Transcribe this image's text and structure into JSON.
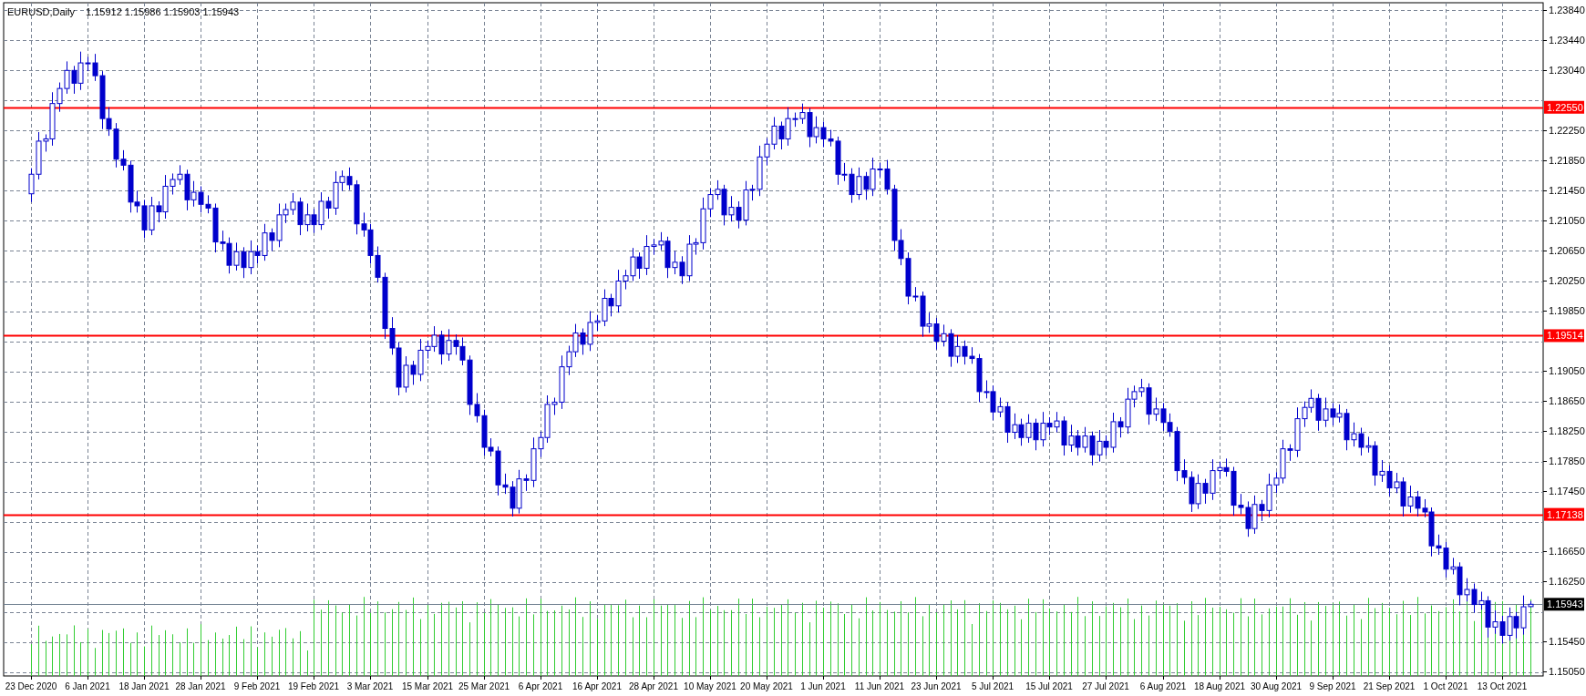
{
  "header": {
    "ohlc": "1.15912 1.15986 1.15903 1.15943"
  },
  "chart": {
    "chart_data": {
      "type": "candlestick",
      "title": "EURUSD,Daily",
      "grid": true,
      "categories": [
        "23 Dec 2020",
        null,
        null,
        null,
        null,
        null,
        null,
        null,
        "6 Jan 2021",
        null,
        null,
        null,
        null,
        null,
        null,
        null,
        "18 Jan 2021",
        null,
        null,
        null,
        null,
        null,
        null,
        null,
        "28 Jan 2021",
        null,
        null,
        null,
        null,
        null,
        null,
        null,
        "9 Feb 2021",
        null,
        null,
        null,
        null,
        null,
        null,
        null,
        "19 Feb 2021",
        null,
        null,
        null,
        null,
        null,
        null,
        null,
        "3 Mar 2021",
        null,
        null,
        null,
        null,
        null,
        null,
        null,
        "15 Mar 2021",
        null,
        null,
        null,
        null,
        null,
        null,
        null,
        "25 Mar 2021",
        null,
        null,
        null,
        null,
        null,
        null,
        null,
        "6 Apr 2021",
        null,
        null,
        null,
        null,
        null,
        null,
        null,
        "16 Apr 2021",
        null,
        null,
        null,
        null,
        null,
        null,
        null,
        "28 Apr 2021",
        null,
        null,
        null,
        null,
        null,
        null,
        null,
        "10 May 2021",
        null,
        null,
        null,
        null,
        null,
        null,
        null,
        "20 May 2021",
        null,
        null,
        null,
        null,
        null,
        null,
        null,
        "1 Jun 2021",
        null,
        null,
        null,
        null,
        null,
        null,
        null,
        "11 Jun 2021",
        null,
        null,
        null,
        null,
        null,
        null,
        null,
        "23 Jun 2021",
        null,
        null,
        null,
        null,
        null,
        null,
        null,
        "5 Jul 2021",
        null,
        null,
        null,
        null,
        null,
        null,
        null,
        "15 Jul 2021",
        null,
        null,
        null,
        null,
        null,
        null,
        null,
        "27 Jul 2021",
        null,
        null,
        null,
        null,
        null,
        null,
        null,
        "6 Aug 2021",
        null,
        null,
        null,
        null,
        null,
        null,
        null,
        "18 Aug 2021",
        null,
        null,
        null,
        null,
        null,
        null,
        null,
        "30 Aug 2021",
        null,
        null,
        null,
        null,
        null,
        null,
        null,
        "9 Sep 2021",
        null,
        null,
        null,
        null,
        null,
        null,
        null,
        "21 Sep 2021",
        null,
        null,
        null,
        null,
        null,
        null,
        null,
        "1 Oct 2021",
        null,
        null,
        null,
        null,
        null,
        null,
        null,
        "13 Oct 2021",
        null,
        null,
        null,
        null
      ],
      "ohlc": [
        [
          1.214,
          1.2174,
          1.2129,
          1.2166
        ],
        [
          1.2166,
          1.2222,
          1.2159,
          1.221
        ],
        [
          1.221,
          1.2219,
          1.2196,
          1.2213
        ],
        [
          1.2213,
          1.2275,
          1.2204,
          1.226
        ],
        [
          1.226,
          1.2288,
          1.2249,
          1.228
        ],
        [
          1.228,
          1.2316,
          1.2273,
          1.2304
        ],
        [
          1.2304,
          1.231,
          1.2273,
          1.2287
        ],
        [
          1.2287,
          1.2329,
          1.2278,
          1.2314
        ],
        [
          1.2314,
          1.2322,
          1.2303,
          1.2314
        ],
        [
          1.2314,
          1.2326,
          1.229,
          1.2297
        ],
        [
          1.2297,
          1.2303,
          1.2226,
          1.224
        ],
        [
          1.224,
          1.2255,
          1.2217,
          1.2226
        ],
        [
          1.2226,
          1.2234,
          1.2175,
          1.2186
        ],
        [
          1.2186,
          1.2198,
          1.2171,
          1.2178
        ],
        [
          1.2178,
          1.2184,
          1.2115,
          1.2129
        ],
        [
          1.2129,
          1.2144,
          1.2115,
          1.2124
        ],
        [
          1.2124,
          1.2132,
          1.2081,
          1.2092
        ],
        [
          1.2092,
          1.2136,
          1.2085,
          1.2124
        ],
        [
          1.2124,
          1.213,
          1.2102,
          1.2116
        ],
        [
          1.2116,
          1.2165,
          1.2107,
          1.215
        ],
        [
          1.215,
          1.2167,
          1.2139,
          1.2159
        ],
        [
          1.2159,
          1.2178,
          1.2152,
          1.2166
        ],
        [
          1.2166,
          1.2172,
          1.2118,
          1.2132
        ],
        [
          1.2132,
          1.2157,
          1.2123,
          1.2142
        ],
        [
          1.2142,
          1.215,
          1.2115,
          1.2126
        ],
        [
          1.2126,
          1.2138,
          1.2114,
          1.2121
        ],
        [
          1.2121,
          1.2127,
          1.2062,
          1.2076
        ],
        [
          1.2076,
          1.2091,
          1.2065,
          1.2074
        ],
        [
          1.2074,
          1.2082,
          1.2034,
          1.2045
        ],
        [
          1.2045,
          1.2075,
          1.2038,
          1.2063
        ],
        [
          1.2063,
          1.2069,
          1.2028,
          1.2042
        ],
        [
          1.2042,
          1.2078,
          1.2033,
          1.2063
        ],
        [
          1.2063,
          1.2071,
          1.2047,
          1.2058
        ],
        [
          1.2058,
          1.21,
          1.2051,
          1.2088
        ],
        [
          1.2088,
          1.2094,
          1.2064,
          1.2078
        ],
        [
          1.2078,
          1.2127,
          1.2069,
          1.2112
        ],
        [
          1.2112,
          1.2127,
          1.2101,
          1.2119
        ],
        [
          1.2119,
          1.2141,
          1.2112,
          1.2129
        ],
        [
          1.2129,
          1.2135,
          1.2085,
          1.2099
        ],
        [
          1.2099,
          1.2127,
          1.209,
          1.2112
        ],
        [
          1.2112,
          1.212,
          1.2088,
          1.2099
        ],
        [
          1.2099,
          1.2142,
          1.2092,
          1.213
        ],
        [
          1.213,
          1.2136,
          1.2107,
          1.2121
        ],
        [
          1.2121,
          1.217,
          1.2112,
          1.2155
        ],
        [
          1.2155,
          1.2171,
          1.2144,
          1.2163
        ],
        [
          1.2163,
          1.2175,
          1.2145,
          1.2152
        ],
        [
          1.2152,
          1.2158,
          1.2086,
          1.21
        ],
        [
          1.21,
          1.2115,
          1.2083,
          1.2092
        ],
        [
          1.2092,
          1.21,
          1.2047,
          1.2058
        ],
        [
          1.2058,
          1.207,
          1.2022,
          1.2029
        ],
        [
          1.2029,
          1.2035,
          1.1947,
          1.1961
        ],
        [
          1.1961,
          1.1976,
          1.1926,
          1.1935
        ],
        [
          1.1935,
          1.1943,
          1.1872,
          1.1883
        ],
        [
          1.1883,
          1.1924,
          1.1876,
          1.1912
        ],
        [
          1.1912,
          1.1918,
          1.1886,
          1.19
        ],
        [
          1.19,
          1.1947,
          1.1891,
          1.1932
        ],
        [
          1.1932,
          1.1945,
          1.1921,
          1.1937
        ],
        [
          1.1937,
          1.1964,
          1.193,
          1.1952
        ],
        [
          1.1952,
          1.1958,
          1.1913,
          1.1927
        ],
        [
          1.1927,
          1.196,
          1.1918,
          1.1945
        ],
        [
          1.1945,
          1.1953,
          1.1926,
          1.1937
        ],
        [
          1.1937,
          1.1949,
          1.1912,
          1.1919
        ],
        [
          1.1919,
          1.1925,
          1.1846,
          1.186
        ],
        [
          1.186,
          1.1875,
          1.1836,
          1.1845
        ],
        [
          1.1845,
          1.1853,
          1.1792,
          1.1803
        ],
        [
          1.1803,
          1.1815,
          1.1791,
          1.1798
        ],
        [
          1.1798,
          1.1804,
          1.1739,
          1.1753
        ],
        [
          1.1753,
          1.1768,
          1.1741,
          1.175
        ],
        [
          1.175,
          1.1758,
          1.1711,
          1.1722
        ],
        [
          1.1722,
          1.1773,
          1.1715,
          1.1761
        ],
        [
          1.1761,
          1.1767,
          1.1745,
          1.1759
        ],
        [
          1.1759,
          1.1816,
          1.175,
          1.1801
        ],
        [
          1.1801,
          1.1824,
          1.179,
          1.1816
        ],
        [
          1.1816,
          1.1872,
          1.1809,
          1.186
        ],
        [
          1.186,
          1.1869,
          1.1846,
          1.1863
        ],
        [
          1.1863,
          1.1925,
          1.1854,
          1.191
        ],
        [
          1.191,
          1.1938,
          1.1899,
          1.193
        ],
        [
          1.193,
          1.1967,
          1.1923,
          1.1955
        ],
        [
          1.1955,
          1.1961,
          1.1926,
          1.194
        ],
        [
          1.194,
          1.1984,
          1.1931,
          1.1969
        ],
        [
          1.1969,
          1.1979,
          1.1958,
          1.1971
        ],
        [
          1.1971,
          1.2013,
          1.1964,
          1.2001
        ],
        [
          1.2001,
          1.2007,
          1.1977,
          1.1991
        ],
        [
          1.1991,
          1.2039,
          1.1982,
          1.2024
        ],
        [
          1.2024,
          1.2039,
          1.2013,
          1.2031
        ],
        [
          1.2031,
          1.2068,
          1.2024,
          1.2056
        ],
        [
          1.2056,
          1.2062,
          1.2027,
          1.2041
        ],
        [
          1.2041,
          1.2085,
          1.2032,
          1.207
        ],
        [
          1.207,
          1.208,
          1.2059,
          1.2072
        ],
        [
          1.2072,
          1.2089,
          1.2065,
          1.2077
        ],
        [
          1.2077,
          1.2083,
          1.2028,
          1.2042
        ],
        [
          1.2042,
          1.2064,
          1.2033,
          1.2049
        ],
        [
          1.2049,
          1.2057,
          1.202,
          1.2031
        ],
        [
          1.2031,
          1.2085,
          1.2024,
          1.2073
        ],
        [
          1.2073,
          1.2081,
          1.2059,
          1.2075
        ],
        [
          1.2075,
          1.2135,
          1.2066,
          1.212
        ],
        [
          1.212,
          1.2147,
          1.2109,
          1.2139
        ],
        [
          1.2139,
          1.2158,
          1.2132,
          1.2146
        ],
        [
          1.2146,
          1.2152,
          1.2098,
          1.2112
        ],
        [
          1.2112,
          1.2137,
          1.2103,
          1.2122
        ],
        [
          1.2122,
          1.213,
          1.2094,
          1.2105
        ],
        [
          1.2105,
          1.2157,
          1.2098,
          1.2145
        ],
        [
          1.2145,
          1.2152,
          1.2131,
          1.2146
        ],
        [
          1.2146,
          1.2204,
          1.2137,
          1.2189
        ],
        [
          1.2189,
          1.2214,
          1.2178,
          1.2206
        ],
        [
          1.2206,
          1.2242,
          1.2199,
          1.223
        ],
        [
          1.223,
          1.2236,
          1.2199,
          1.2213
        ],
        [
          1.2213,
          1.2255,
          1.2204,
          1.224
        ],
        [
          1.224,
          1.2248,
          1.2229,
          1.224
        ],
        [
          1.224,
          1.226,
          1.2233,
          1.2248
        ],
        [
          1.2248,
          1.2254,
          1.2202,
          1.2216
        ],
        [
          1.2216,
          1.2243,
          1.2207,
          1.2228
        ],
        [
          1.2228,
          1.2236,
          1.2202,
          1.2213
        ],
        [
          1.2213,
          1.2225,
          1.2203,
          1.221
        ],
        [
          1.221,
          1.2216,
          1.2152,
          1.2166
        ],
        [
          1.2166,
          1.2181,
          1.2157,
          1.2166
        ],
        [
          1.2166,
          1.2174,
          1.2128,
          1.2139
        ],
        [
          1.2139,
          1.2175,
          1.2132,
          1.2163
        ],
        [
          1.2163,
          1.2169,
          1.2132,
          1.2146
        ],
        [
          1.2146,
          1.2188,
          1.2137,
          1.2173
        ],
        [
          1.2173,
          1.2181,
          1.2162,
          1.2173
        ],
        [
          1.2173,
          1.2185,
          1.2139,
          1.2146
        ],
        [
          1.2146,
          1.2152,
          1.2064,
          1.2078
        ],
        [
          1.2078,
          1.2093,
          1.2045,
          1.2054
        ],
        [
          1.2054,
          1.2062,
          1.1993,
          1.2004
        ],
        [
          1.2004,
          1.2016,
          1.1997,
          1.2004
        ],
        [
          1.2004,
          1.201,
          1.195,
          1.1964
        ],
        [
          1.1964,
          1.1982,
          1.1955,
          1.1967
        ],
        [
          1.1967,
          1.1975,
          1.1933,
          1.1944
        ],
        [
          1.1944,
          1.1966,
          1.1937,
          1.1954
        ],
        [
          1.1954,
          1.196,
          1.191,
          1.1924
        ],
        [
          1.1924,
          1.1952,
          1.1915,
          1.1937
        ],
        [
          1.1937,
          1.1945,
          1.1913,
          1.1924
        ],
        [
          1.1924,
          1.1936,
          1.1914,
          1.1921
        ],
        [
          1.1921,
          1.1927,
          1.1863,
          1.1877
        ],
        [
          1.1877,
          1.1892,
          1.1868,
          1.1877
        ],
        [
          1.1877,
          1.1885,
          1.1839,
          1.185
        ],
        [
          1.185,
          1.1869,
          1.1843,
          1.1857
        ],
        [
          1.1857,
          1.1863,
          1.1809,
          1.1823
        ],
        [
          1.1823,
          1.1848,
          1.1814,
          1.1833
        ],
        [
          1.1833,
          1.1841,
          1.1805,
          1.1816
        ],
        [
          1.1816,
          1.1847,
          1.1809,
          1.1835
        ],
        [
          1.1835,
          1.1841,
          1.1799,
          1.1813
        ],
        [
          1.1813,
          1.185,
          1.1804,
          1.1835
        ],
        [
          1.1835,
          1.1843,
          1.1819,
          1.183
        ],
        [
          1.183,
          1.185,
          1.1823,
          1.1838
        ],
        [
          1.1838,
          1.1844,
          1.1792,
          1.1806
        ],
        [
          1.1806,
          1.1833,
          1.1797,
          1.1818
        ],
        [
          1.1818,
          1.1826,
          1.1792,
          1.1803
        ],
        [
          1.1803,
          1.183,
          1.1796,
          1.1818
        ],
        [
          1.1818,
          1.1824,
          1.1779,
          1.1793
        ],
        [
          1.1793,
          1.1826,
          1.1784,
          1.1811
        ],
        [
          1.1811,
          1.1819,
          1.1792,
          1.1803
        ],
        [
          1.1803,
          1.1849,
          1.1796,
          1.1837
        ],
        [
          1.1837,
          1.1843,
          1.1816,
          1.183
        ],
        [
          1.183,
          1.1882,
          1.1821,
          1.1867
        ],
        [
          1.1867,
          1.1885,
          1.1856,
          1.1877
        ],
        [
          1.1877,
          1.1894,
          1.187,
          1.1882
        ],
        [
          1.1882,
          1.1888,
          1.1833,
          1.1847
        ],
        [
          1.1847,
          1.1869,
          1.1838,
          1.1854
        ],
        [
          1.1854,
          1.1862,
          1.1825,
          1.1836
        ],
        [
          1.1836,
          1.1848,
          1.1817,
          1.1824
        ],
        [
          1.1824,
          1.183,
          1.1758,
          1.1772
        ],
        [
          1.1772,
          1.1787,
          1.1754,
          1.1763
        ],
        [
          1.1763,
          1.1771,
          1.1717,
          1.1728
        ],
        [
          1.1728,
          1.1767,
          1.1721,
          1.1755
        ],
        [
          1.1755,
          1.1761,
          1.1728,
          1.1742
        ],
        [
          1.1742,
          1.1787,
          1.1733,
          1.1772
        ],
        [
          1.1772,
          1.1784,
          1.1761,
          1.1776
        ],
        [
          1.1776,
          1.1788,
          1.1764,
          1.1771
        ],
        [
          1.1771,
          1.1777,
          1.1712,
          1.1726
        ],
        [
          1.1726,
          1.1741,
          1.1714,
          1.1723
        ],
        [
          1.1723,
          1.1731,
          1.1684,
          1.1695
        ],
        [
          1.1695,
          1.1739,
          1.1688,
          1.1727
        ],
        [
          1.1727,
          1.1733,
          1.1705,
          1.1719
        ],
        [
          1.1719,
          1.1768,
          1.171,
          1.1753
        ],
        [
          1.1753,
          1.177,
          1.1742,
          1.1762
        ],
        [
          1.1762,
          1.1813,
          1.1755,
          1.1801
        ],
        [
          1.1801,
          1.1807,
          1.1785,
          1.1799
        ],
        [
          1.1799,
          1.1856,
          1.179,
          1.1841
        ],
        [
          1.1841,
          1.1864,
          1.183,
          1.1856
        ],
        [
          1.1856,
          1.188,
          1.1849,
          1.1868
        ],
        [
          1.1868,
          1.1874,
          1.1825,
          1.1839
        ],
        [
          1.1839,
          1.1869,
          1.183,
          1.1854
        ],
        [
          1.1854,
          1.1862,
          1.1832,
          1.1843
        ],
        [
          1.1843,
          1.186,
          1.1836,
          1.1848
        ],
        [
          1.1848,
          1.1854,
          1.1799,
          1.1813
        ],
        [
          1.1813,
          1.1836,
          1.1804,
          1.1821
        ],
        [
          1.1821,
          1.1829,
          1.1792,
          1.1803
        ],
        [
          1.1803,
          1.1817,
          1.1796,
          1.1805
        ],
        [
          1.1805,
          1.1811,
          1.1752,
          1.1766
        ],
        [
          1.1766,
          1.1786,
          1.1757,
          1.1771
        ],
        [
          1.1771,
          1.1779,
          1.1738,
          1.1749
        ],
        [
          1.1749,
          1.1769,
          1.1742,
          1.1757
        ],
        [
          1.1757,
          1.1763,
          1.1711,
          1.1725
        ],
        [
          1.1725,
          1.1752,
          1.1716,
          1.1737
        ],
        [
          1.1737,
          1.1745,
          1.1711,
          1.1722
        ],
        [
          1.1722,
          1.1734,
          1.171,
          1.1717
        ],
        [
          1.1717,
          1.1723,
          1.1658,
          1.1672
        ],
        [
          1.1672,
          1.1687,
          1.166,
          1.1669
        ],
        [
          1.1669,
          1.1677,
          1.163,
          1.1641
        ],
        [
          1.1641,
          1.1656,
          1.1634,
          1.1644
        ],
        [
          1.1644,
          1.165,
          1.1593,
          1.1607
        ],
        [
          1.1607,
          1.1629,
          1.1598,
          1.1614
        ],
        [
          1.1614,
          1.1622,
          1.1583,
          1.1594
        ],
        [
          1.1594,
          1.1611,
          1.1587,
          1.1599
        ],
        [
          1.1599,
          1.1605,
          1.155,
          1.1564
        ],
        [
          1.1564,
          1.1586,
          1.1555,
          1.1571
        ],
        [
          1.1571,
          1.1579,
          1.1542,
          1.1553
        ],
        [
          1.1553,
          1.159,
          1.1546,
          1.1578
        ],
        [
          1.1578,
          1.1584,
          1.1549,
          1.1563
        ],
        [
          1.1563,
          1.1606,
          1.1554,
          1.1591
        ],
        [
          1.15912,
          1.15986,
          1.15903,
          1.15943
        ]
      ],
      "ylim": [
        1.1499,
        1.2394
      ],
      "yticks": [
        {
          "value": 1.2384,
          "label": "1.23840"
        },
        {
          "value": 1.2344,
          "label": "1.23440"
        },
        {
          "value": 1.2304,
          "label": "1.23040"
        },
        {
          "value": 1.2225,
          "label": "1.22250"
        },
        {
          "value": 1.2185,
          "label": "1.21850"
        },
        {
          "value": 1.2145,
          "label": "1.21450"
        },
        {
          "value": 1.2105,
          "label": "1.21050"
        },
        {
          "value": 1.2065,
          "label": "1.20650"
        },
        {
          "value": 1.2025,
          "label": "1.20250"
        },
        {
          "value": 1.1985,
          "label": "1.19850"
        },
        {
          "value": 1.1905,
          "label": "1.19050"
        },
        {
          "value": 1.1865,
          "label": "1.18650"
        },
        {
          "value": 1.1825,
          "label": "1.18250"
        },
        {
          "value": 1.1785,
          "label": "1.17850"
        },
        {
          "value": 1.1745,
          "label": "1.17450"
        },
        {
          "value": 1.1665,
          "label": "1.16650"
        },
        {
          "value": 1.1625,
          "label": "1.16250"
        },
        {
          "value": 1.1545,
          "label": "1.15450"
        },
        {
          "value": 1.1505,
          "label": "1.15050"
        }
      ],
      "ref_lines": [
        {
          "axis": "y",
          "value": 1.2255,
          "label": "1.22550",
          "color": "#ff0000"
        },
        {
          "axis": "y",
          "value": 1.19514,
          "label": "1.19514",
          "color": "#ff0000"
        },
        {
          "axis": "y",
          "value": 1.17138,
          "label": "1.17138",
          "color": "#ff0000"
        },
        {
          "axis": "y",
          "value": 1.15943,
          "label": "1.15943",
          "color": "#708090"
        }
      ]
    }
  }
}
